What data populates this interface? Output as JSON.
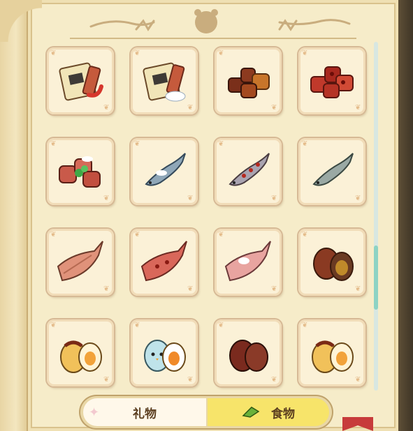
{
  "tabs": {
    "gift_label": "礼物",
    "food_label": "食物",
    "active": "food"
  },
  "scrollbar": {
    "position_fraction": 0.62
  },
  "items": [
    {
      "icon": "dried-meat-chili-icon"
    },
    {
      "icon": "dried-meat-salt-icon"
    },
    {
      "icon": "braised-meat-chunks-icon"
    },
    {
      "icon": "spicy-meat-chunks-icon"
    },
    {
      "icon": "meat-chunks-herbs-icon"
    },
    {
      "icon": "salted-fish-icon"
    },
    {
      "icon": "spicy-fish-icon"
    },
    {
      "icon": "fish-icon"
    },
    {
      "icon": "dried-fish-fillet-icon"
    },
    {
      "icon": "spicy-fish-fillet-icon"
    },
    {
      "icon": "salted-fish-fillet-icon"
    },
    {
      "icon": "braised-egg-icon"
    },
    {
      "icon": "chick-egg-sauce-icon"
    },
    {
      "icon": "chick-egg-salted-icon"
    },
    {
      "icon": "tea-egg-icon"
    },
    {
      "icon": "chick-egg-sauce-2-icon"
    }
  ]
}
